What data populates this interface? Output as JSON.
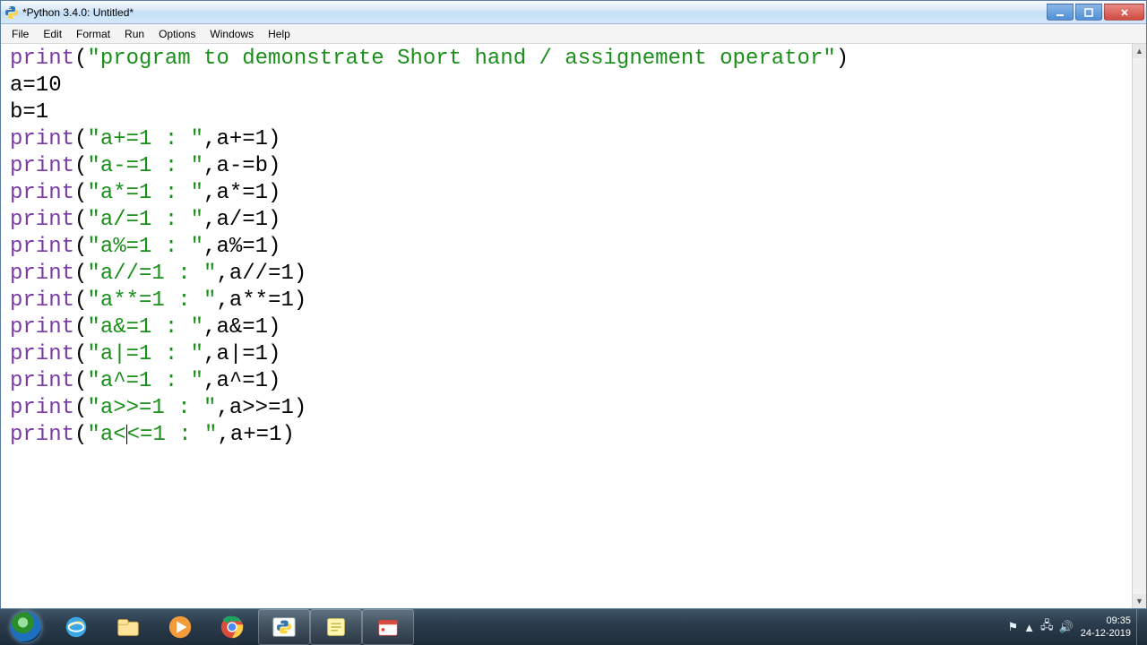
{
  "window": {
    "title": "*Python 3.4.0: Untitled*"
  },
  "menu": {
    "file": "File",
    "edit": "Edit",
    "format": "Format",
    "run": "Run",
    "options": "Options",
    "windows": "Windows",
    "help": "Help"
  },
  "code": {
    "lines": [
      {
        "pre": "print",
        "open": "(",
        "str": "\"program to demonstrate Short hand / assignement operator\"",
        "rest": ")"
      },
      {
        "plain": "a=10"
      },
      {
        "plain": "b=1"
      },
      {
        "pre": "print",
        "open": "(",
        "str": "\"a+=1 : \"",
        "rest": ",a+=1)"
      },
      {
        "pre": "print",
        "open": "(",
        "str": "\"a-=1 : \"",
        "rest": ",a-=b)"
      },
      {
        "pre": "print",
        "open": "(",
        "str": "\"a*=1 : \"",
        "rest": ",a*=1)"
      },
      {
        "pre": "print",
        "open": "(",
        "str": "\"a/=1 : \"",
        "rest": ",a/=1)"
      },
      {
        "pre": "print",
        "open": "(",
        "str": "\"a%=1 : \"",
        "rest": ",a%=1)"
      },
      {
        "pre": "print",
        "open": "(",
        "str": "\"a//=1 : \"",
        "rest": ",a//=1)"
      },
      {
        "pre": "print",
        "open": "(",
        "str": "\"a**=1 : \"",
        "rest": ",a**=1)"
      },
      {
        "pre": "print",
        "open": "(",
        "str": "\"a&=1 : \"",
        "rest": ",a&=1)"
      },
      {
        "pre": "print",
        "open": "(",
        "str": "\"a|=1 : \"",
        "rest": ",a|=1)"
      },
      {
        "pre": "print",
        "open": "(",
        "str": "\"a^=1 : \"",
        "rest": ",a^=1)"
      },
      {
        "pre": "print",
        "open": "(",
        "str": "\"a>>=1 : \"",
        "rest": ",a>>=1)"
      },
      {
        "pre": "print",
        "open": "(",
        "str": "\"a<<=1 : \"",
        "rest": ",a+=1)"
      }
    ],
    "cursor": {
      "line": 14,
      "col_after_segment": "str_pos4"
    }
  },
  "tray": {
    "time": "09:35",
    "date": "24-12-2019"
  }
}
